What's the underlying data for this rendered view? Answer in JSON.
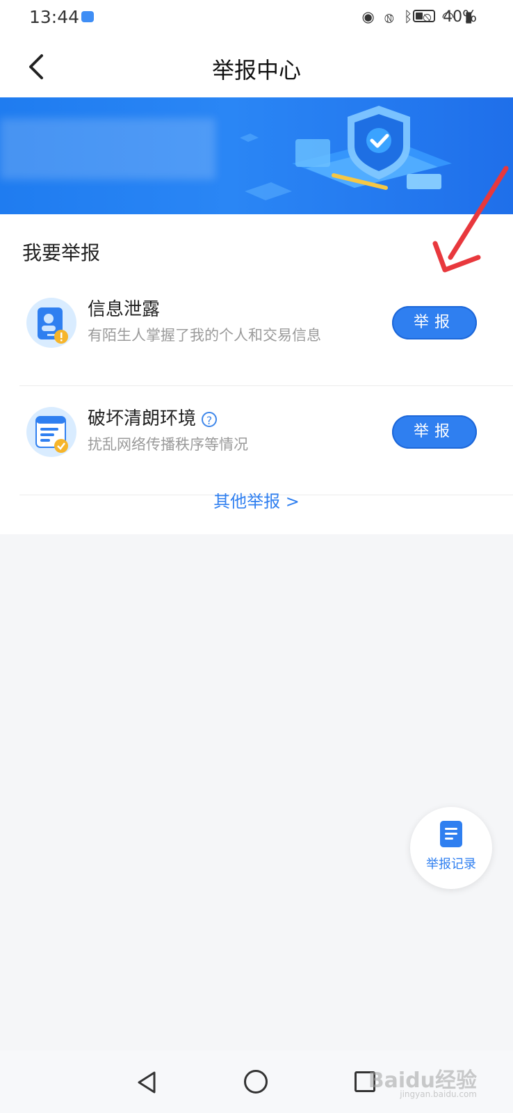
{
  "status_bar": {
    "time": "13:44",
    "icons": [
      "eye-icon",
      "nfc-icon",
      "bluetooth-icon",
      "bell-off-icon",
      "wifi-icon",
      "signal-icon"
    ],
    "battery": "40%"
  },
  "nav": {
    "title": "举报中心"
  },
  "section": {
    "title": "我要举报",
    "items": [
      {
        "title": "信息泄露",
        "desc": "有陌生人掌握了我的个人和交易信息",
        "button": "举报"
      },
      {
        "title": "破坏清朗环境",
        "desc": "扰乱网络传播秩序等情况",
        "button": "举报"
      }
    ],
    "other_link": "其他举报 >"
  },
  "fab": {
    "label": "举报记录"
  },
  "watermark": {
    "text": "Baidu经验",
    "sub": "jingyan.baidu.com"
  },
  "colors": {
    "accent": "#2f7ff0",
    "banner": "#1f7cf0",
    "annotation_arrow": "#e8383d"
  }
}
